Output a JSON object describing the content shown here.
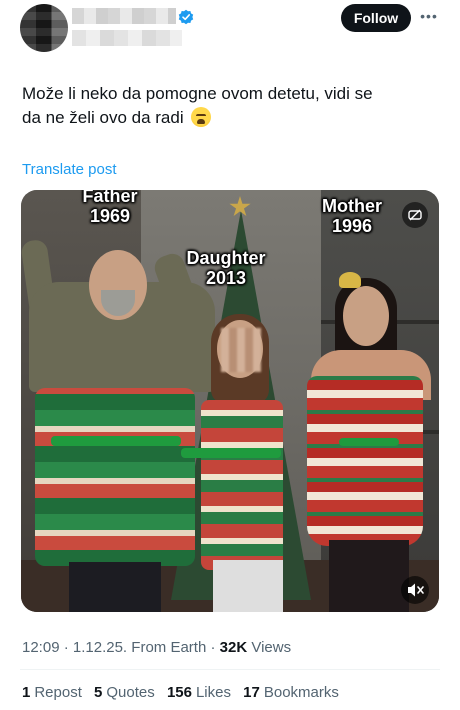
{
  "header": {
    "follow_label": "Follow",
    "more_icon": "more-horizontal-icon",
    "verified_icon": "verified-badge-icon"
  },
  "post": {
    "text_line1": "Može li neko da pomogne ovom detetu, vidi se",
    "text_line2": "da ne želi ovo da radi",
    "emoji": "weary-face-emoji",
    "translate_label": "Translate post"
  },
  "media": {
    "labels": {
      "father_name": "Father",
      "father_year": "1969",
      "daughter_name": "Daughter",
      "daughter_year": "2013",
      "mother_name": "Mother",
      "mother_year": "1996"
    },
    "corner_icon": "no-sound-badge-icon",
    "mute_icon": "muted-speaker-icon"
  },
  "meta": {
    "time": "12:09",
    "date": "1.12.25.",
    "source": "From Earth",
    "views_count": "32K",
    "views_label": "Views"
  },
  "stats": [
    {
      "num": "1",
      "label": "Repost"
    },
    {
      "num": "5",
      "label": "Quotes"
    },
    {
      "num": "156",
      "label": "Likes"
    },
    {
      "num": "17",
      "label": "Bookmarks"
    }
  ],
  "colors": {
    "accent": "#1d9bf0",
    "text": "#0f1419",
    "muted": "#536471"
  }
}
